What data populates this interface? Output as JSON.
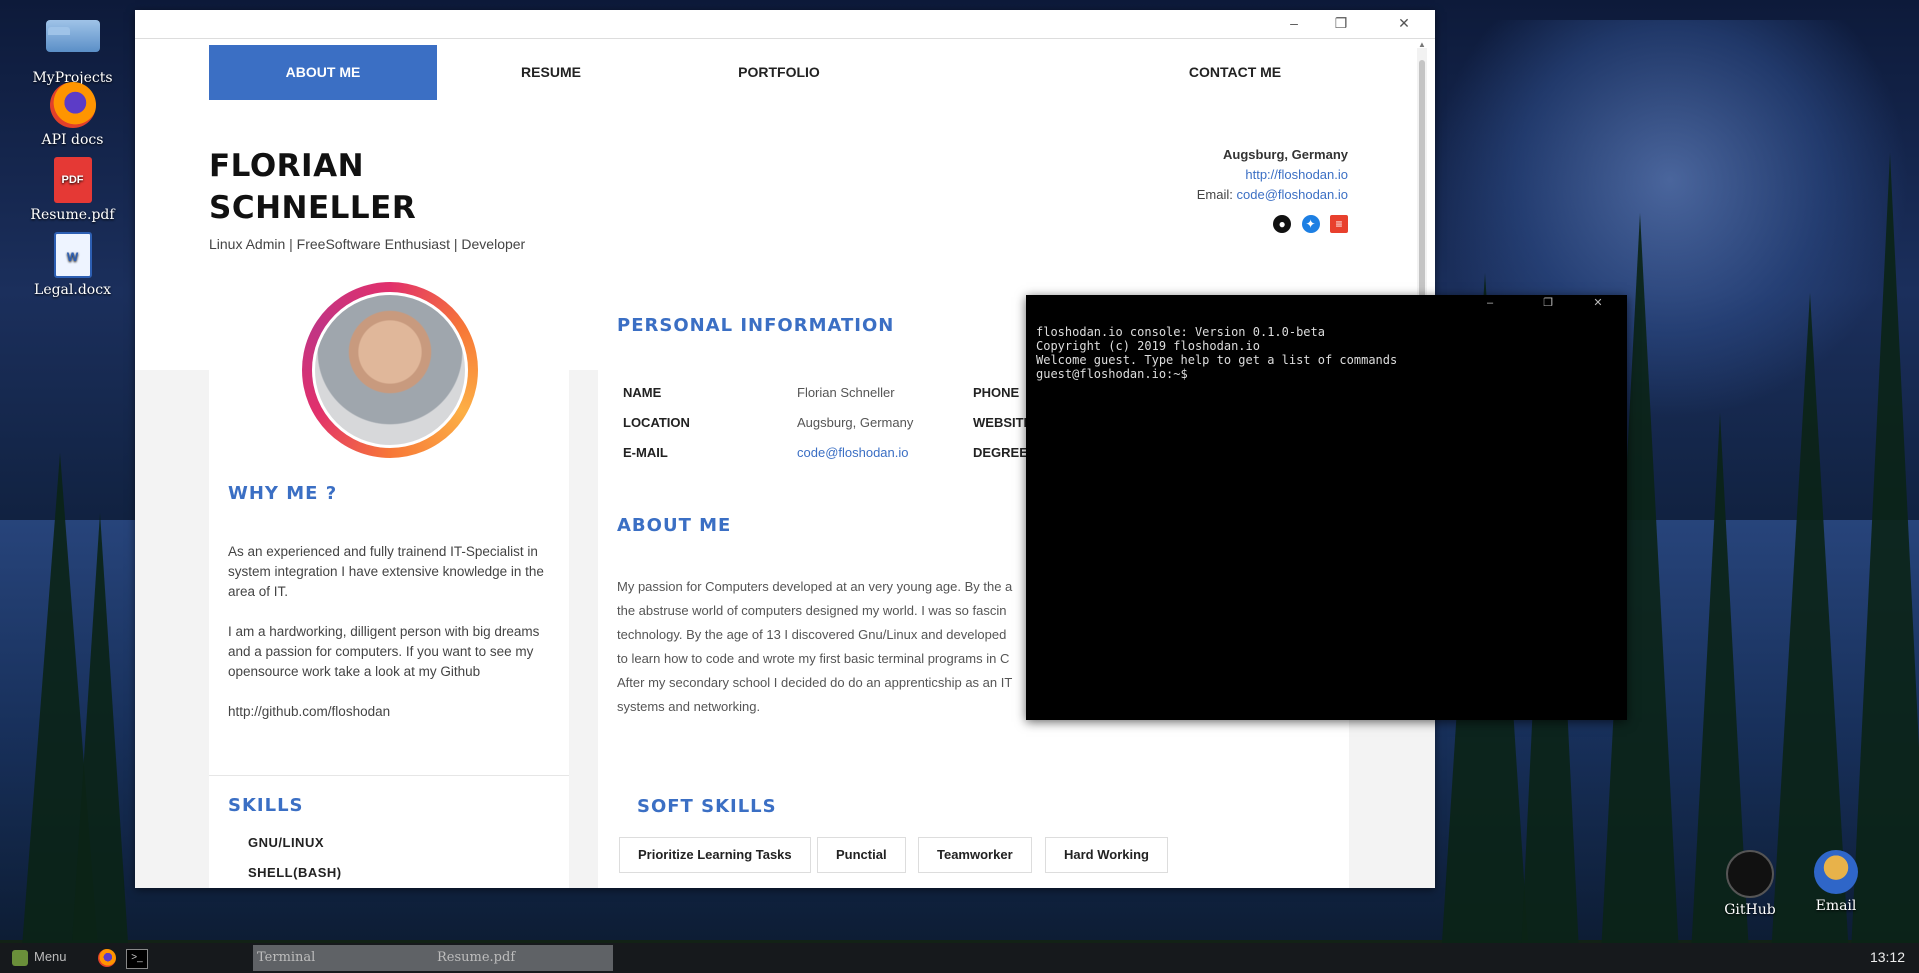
{
  "desktop": {
    "icons": [
      {
        "label": "MyProjects",
        "icon": "folder-icon"
      },
      {
        "label": "API docs",
        "icon": "firefox-icon"
      },
      {
        "label": "Resume.pdf",
        "icon": "pdf-icon",
        "badge": "PDF"
      },
      {
        "label": "Legal.docx",
        "icon": "docx-icon",
        "badge": "W"
      }
    ],
    "right_icons": [
      {
        "label": "GitHub",
        "icon": "github-icon"
      },
      {
        "label": "Email",
        "icon": "email-icon"
      }
    ]
  },
  "browser": {
    "nav": [
      "ABOUT ME",
      "RESUME",
      "PORTFOLIO",
      "CONTACT ME"
    ],
    "active_nav": "ABOUT ME",
    "name_line1": "FLORIAN",
    "name_line2": "SCHNELLER",
    "tagline": "Linux Admin | FreeSoftware Enthusiast | Developer",
    "contact": {
      "city": "Augsburg, Germany",
      "website": "http://floshodan.io",
      "email_label": "Email:",
      "email": "code@floshodan.io"
    },
    "why_title": "WHY ME ?",
    "why_paragraphs": [
      "As an experienced and fully trainend IT-Specialist in system integration I have extensive knowledge in the area of IT.",
      "I am a hardworking, dilligent person with big dreams and a passion for computers. If you want to see my opensource work take a look at my Github",
      "http://github.com/floshodan"
    ],
    "skills_title": "SKILLS",
    "skills": [
      "GNU/LINUX",
      "SHELL(BASH)"
    ],
    "personal_title": "PERSONAL INFORMATION",
    "info": {
      "name_label": "NAME",
      "name_value": "Florian Schneller",
      "location_label": "LOCATION",
      "location_value": "Augsburg, Germany",
      "email_label": "E-MAIL",
      "email_value": "code@floshodan.io",
      "phone_label": "PHONE",
      "website_label": "WEBSITE",
      "degree_label": "DEGREE"
    },
    "about_title": "ABOUT ME",
    "about_lines": [
      "My passion for Computers developed at an very young age. By the a",
      "the abstruse world of computers designed my world. I was so fascin",
      "technology. By the age of 13 I discovered Gnu/Linux and developed",
      "to learn how to code and wrote my first basic terminal programs in C",
      "After my secondary school I decided do do an apprenticship as an IT",
      "systems and networking."
    ],
    "soft_title": "SOFT SKILLS",
    "soft_skills": [
      "Prioritize Learning Tasks",
      "Punctial",
      "Teamworker",
      "Hard Working"
    ]
  },
  "terminal": {
    "lines": [
      "floshodan.io console: Version 0.1.0-beta",
      "Copyright (c) 2019 floshodan.io",
      "",
      "Welcome guest. Type help to get a list of commands",
      "",
      "",
      "guest@floshodan.io:~$"
    ]
  },
  "taskbar": {
    "menu_label": "Menu",
    "tasks": [
      "Terminal",
      "Resume.pdf"
    ],
    "clock": "13:12"
  },
  "colors": {
    "accent": "#3b6fc4",
    "terminal_bg": "#000000",
    "taskbar_bg": "#16191c"
  }
}
